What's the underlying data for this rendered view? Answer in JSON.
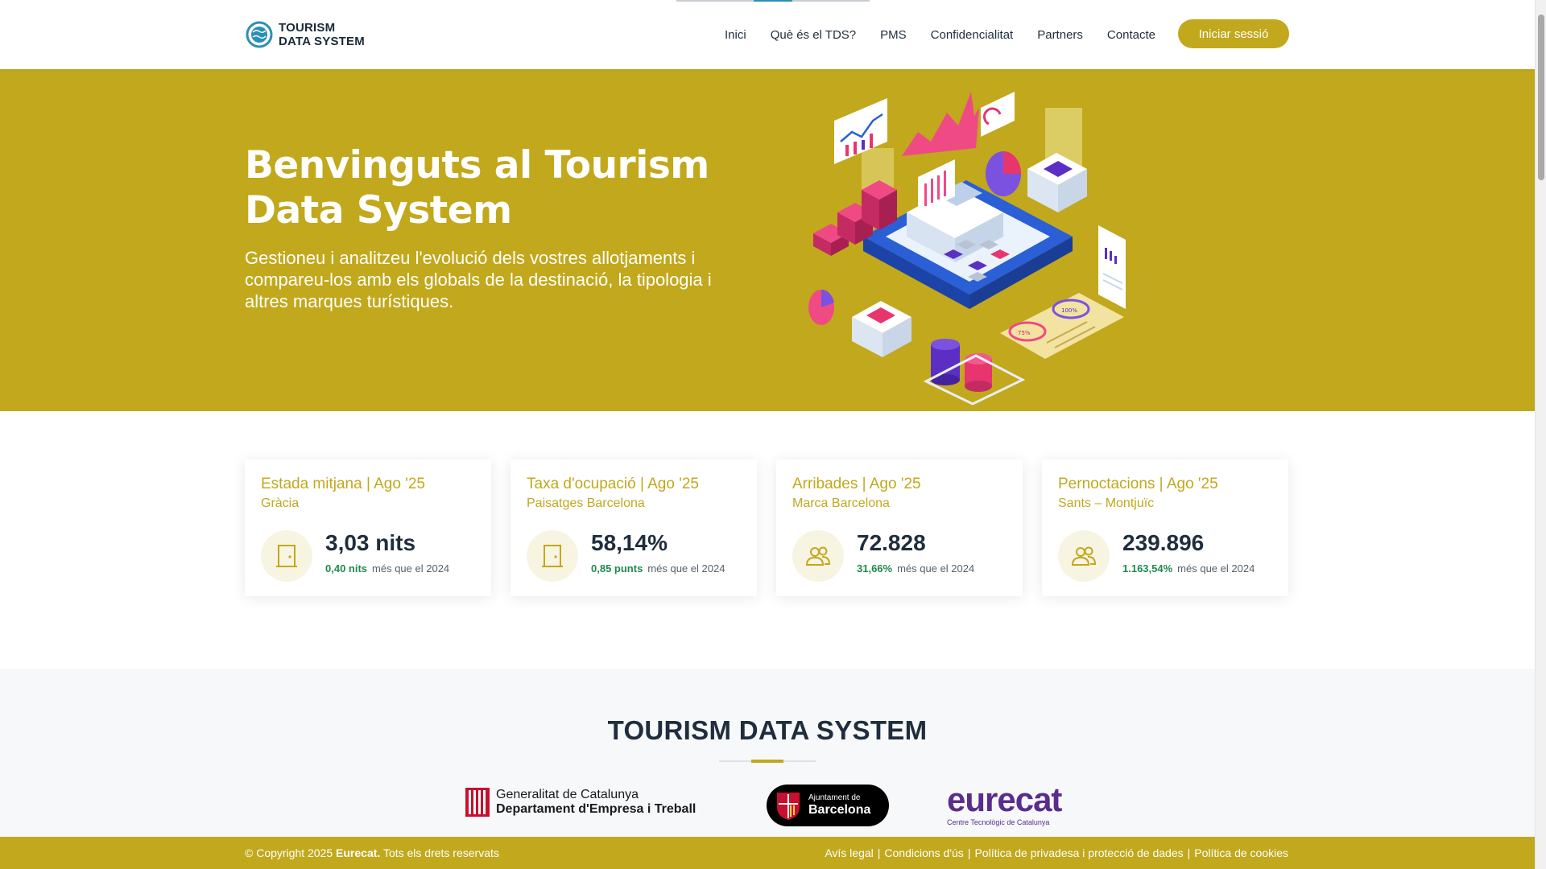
{
  "brand": {
    "line1": "TOURISM",
    "line2": "DATA SYSTEM",
    "accent_color": "#c2a81c",
    "logo_color": "#2c8fb8"
  },
  "nav": {
    "items": [
      "Inici",
      "Què és el TDS?",
      "PMS",
      "Confidencialitat",
      "Partners",
      "Contacte"
    ],
    "login_label": "Iniciar sessió"
  },
  "hero": {
    "title": "Benvinguts al Tourism Data System",
    "subtitle": "Gestioneu i analitzeu l'evolució dels vostres allotjaments i compareu-los amb els globals de la destinació, la tipologia i altres marques turístiques."
  },
  "stats": [
    {
      "title": "Estada mitjana | Ago '25",
      "location": "Gràcia",
      "value": "3,03 nits",
      "delta": "0,40 nits",
      "delta_text": "més que el 2024",
      "icon": "door-icon"
    },
    {
      "title": "Taxa d'ocupació | Ago '25",
      "location": "Paisatges Barcelona",
      "value": "58,14%",
      "delta": "0,85 punts",
      "delta_text": "més que el 2024",
      "icon": "door-icon"
    },
    {
      "title": "Arribades | Ago '25",
      "location": "Marca Barcelona",
      "value": "72.828",
      "delta": "31,66%",
      "delta_text": "més que el 2024",
      "icon": "users-icon"
    },
    {
      "title": "Pernoctacions | Ago '25",
      "location": "Sants – Montjuïc",
      "value": "239.896",
      "delta": "1.163,54%",
      "delta_text": "més que el 2024",
      "icon": "users-icon"
    }
  ],
  "partners": {
    "title": "TOURISM DATA SYSTEM",
    "gencat_line1": "Generalitat de Catalunya",
    "gencat_line2": "Departament d'Empresa i Treball",
    "bcn_line1": "Ajuntament de",
    "bcn_line2": "Barcelona",
    "eurecat_name": "eurecat",
    "eurecat_sub": "Centre Tecnològic de Catalunya"
  },
  "footer": {
    "copy_prefix": "© Copyright 2025",
    "copy_brand": "Eurecat.",
    "copy_suffix": "Tots els drets reservats",
    "links": [
      "Avís legal",
      "Condicions d'ús",
      "Política de privadesa i protecció de dades",
      "Política de cookies"
    ],
    "separator": "|"
  },
  "illustration": {
    "chart_label_1": "75%",
    "chart_label_2": "100%"
  }
}
